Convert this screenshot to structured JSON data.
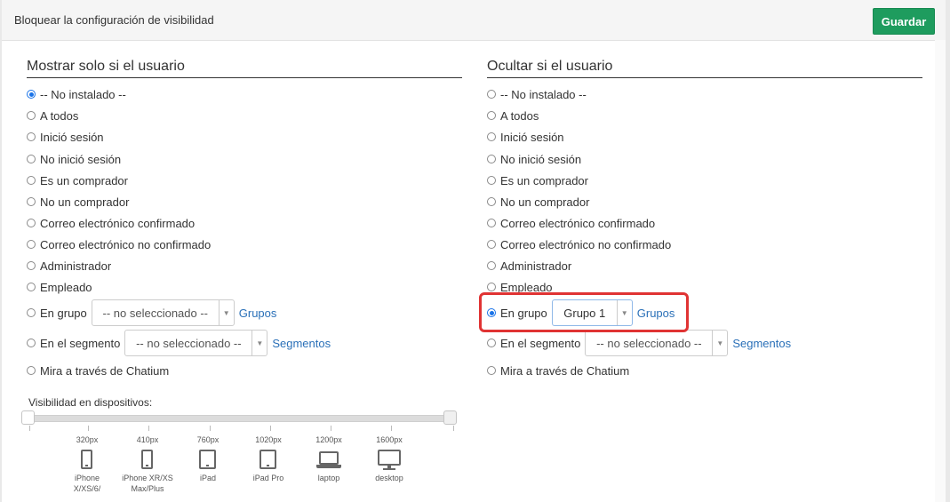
{
  "dialog": {
    "title": "Bloquear la configuración de visibilidad",
    "save_label": "Guardar"
  },
  "show_section": {
    "heading": "Mostrar solo si el usuario",
    "options": [
      "-- No instalado --",
      "A todos",
      "Inició sesión",
      "No inició sesión",
      "Es un comprador",
      "No un comprador",
      "Correo electrónico confirmado",
      "Correo electrónico no confirmado",
      "Administrador",
      "Empleado"
    ],
    "selected_index": 0,
    "group_label": "En grupo",
    "group_select": "-- no seleccionado --",
    "group_link": "Grupos",
    "segment_label": "En el segmento",
    "segment_select": "-- no seleccionado --",
    "segment_link": "Segmentos",
    "chatium_label": "Mira a través de Chatium"
  },
  "hide_section": {
    "heading": "Ocultar si el usuario",
    "options": [
      "-- No instalado --",
      "A todos",
      "Inició sesión",
      "No inició sesión",
      "Es un comprador",
      "No un comprador",
      "Correo electrónico confirmado",
      "Correo electrónico no confirmado",
      "Administrador",
      "Empleado"
    ],
    "selected": "En grupo",
    "group_label": "En grupo",
    "group_select": "Grupo 1",
    "group_link": "Grupos",
    "segment_label": "En el segmento",
    "segment_select": "-- no seleccionado --",
    "segment_link": "Segmentos",
    "chatium_label": "Mira a través de Chatium"
  },
  "devices": {
    "label": "Visibilidad en dispositivos:",
    "range_selected": [
      "320px",
      "1600px"
    ],
    "items": [
      {
        "px": "320px",
        "name": "iPhone X/XS/6/",
        "icon": "phone-icon"
      },
      {
        "px": "410px",
        "name": "iPhone XR/XS Max/Plus",
        "icon": "phone-icon"
      },
      {
        "px": "760px",
        "name": "iPad",
        "icon": "tablet-icon"
      },
      {
        "px": "1020px",
        "name": "iPad Pro",
        "icon": "tablet-icon"
      },
      {
        "px": "1200px",
        "name": "laptop",
        "icon": "laptop-icon"
      },
      {
        "px": "1600px",
        "name": "desktop",
        "icon": "desktop-icon"
      }
    ]
  },
  "colors": {
    "save_button": "#1e9c5e",
    "highlight": "#e03333",
    "link": "#2a70b8",
    "radio_checked": "#1a73e8"
  }
}
